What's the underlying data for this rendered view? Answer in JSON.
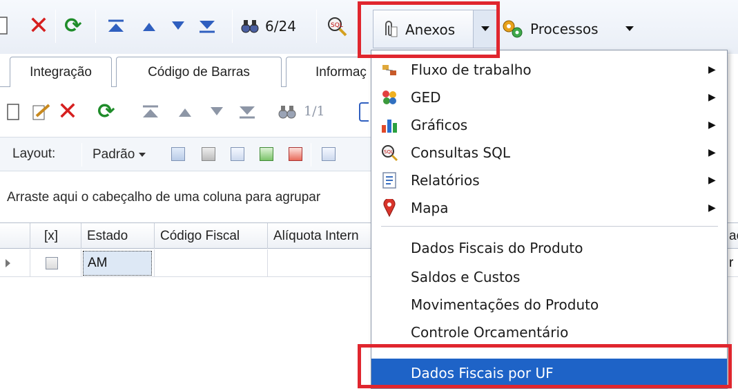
{
  "toolbar": {
    "record_counter": "6/24",
    "anexos_label": "Anexos",
    "processos_label": "Processos"
  },
  "tabs": [
    {
      "label": "Integração"
    },
    {
      "label": "Código de Barras"
    },
    {
      "label": "Informaç"
    }
  ],
  "sub_toolbar": {
    "record_counter": "1/1"
  },
  "layout_bar": {
    "layout_label": "Layout:",
    "layout_value": "Padrão"
  },
  "grid": {
    "group_hint": "Arraste aqui o cabeçalho de uma coluna para agrupar",
    "columns": [
      "[x]",
      "Estado",
      "Código Fiscal",
      "Alíquota Intern"
    ],
    "right_col_fragment": "ac",
    "rows": [
      {
        "checked": false,
        "estado": "AM",
        "codigo_fiscal": "",
        "aliquota": "",
        "right_fragment": "r"
      }
    ]
  },
  "anexos_menu": {
    "items": [
      {
        "label": "Fluxo de trabalho",
        "icon": "workflow-icon",
        "submenu": true
      },
      {
        "label": "GED",
        "icon": "ged-icon",
        "submenu": true
      },
      {
        "label": "Gráficos",
        "icon": "bar-chart-icon",
        "submenu": true
      },
      {
        "label": "Consultas SQL",
        "icon": "sql-query-icon",
        "submenu": true
      },
      {
        "label": "Relatórios",
        "icon": "report-icon",
        "submenu": true
      },
      {
        "label": "Mapa",
        "icon": "map-pin-icon",
        "submenu": true
      }
    ],
    "actions": [
      {
        "label": "Dados Fiscais do Produto"
      },
      {
        "label": "Saldos e Custos"
      },
      {
        "label": "Movimentações do Produto"
      },
      {
        "label": "Controle Orcamentário"
      },
      {
        "label": "Dados Fiscais por UF",
        "selected": true
      }
    ]
  },
  "colors": {
    "highlight_red": "#e0262e",
    "selection_blue": "#1e63c7",
    "delete_red": "#d61f1f",
    "refresh_green": "#1f8c2a"
  }
}
